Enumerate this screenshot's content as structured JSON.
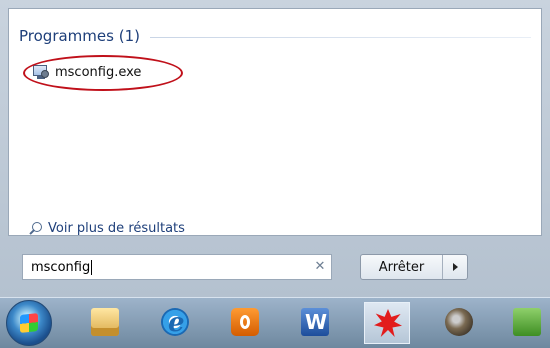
{
  "search_results": {
    "group_title": "Programmes (1)",
    "items": [
      {
        "label": "msconfig.exe",
        "icon": "msconfig-app-icon"
      }
    ],
    "see_more_label": "Voir plus de résultats",
    "highlight_color": "#c0101a"
  },
  "search": {
    "value": "msconfig",
    "clear_glyph": "✕"
  },
  "power": {
    "label": "Arrêter"
  },
  "taskbar": {
    "items": [
      {
        "name": "start-orb",
        "icon": "windows-logo-icon"
      },
      {
        "name": "explorer",
        "icon": "folder-icon"
      },
      {
        "name": "internet-explorer",
        "icon": "internet-explorer-icon"
      },
      {
        "name": "media",
        "icon": "media-player-icon"
      },
      {
        "name": "word",
        "icon": "word-icon"
      },
      {
        "name": "paint-splash",
        "icon": "red-splash-icon",
        "active": true
      },
      {
        "name": "gimp",
        "icon": "gimp-icon"
      },
      {
        "name": "installer",
        "icon": "installer-icon"
      }
    ]
  }
}
